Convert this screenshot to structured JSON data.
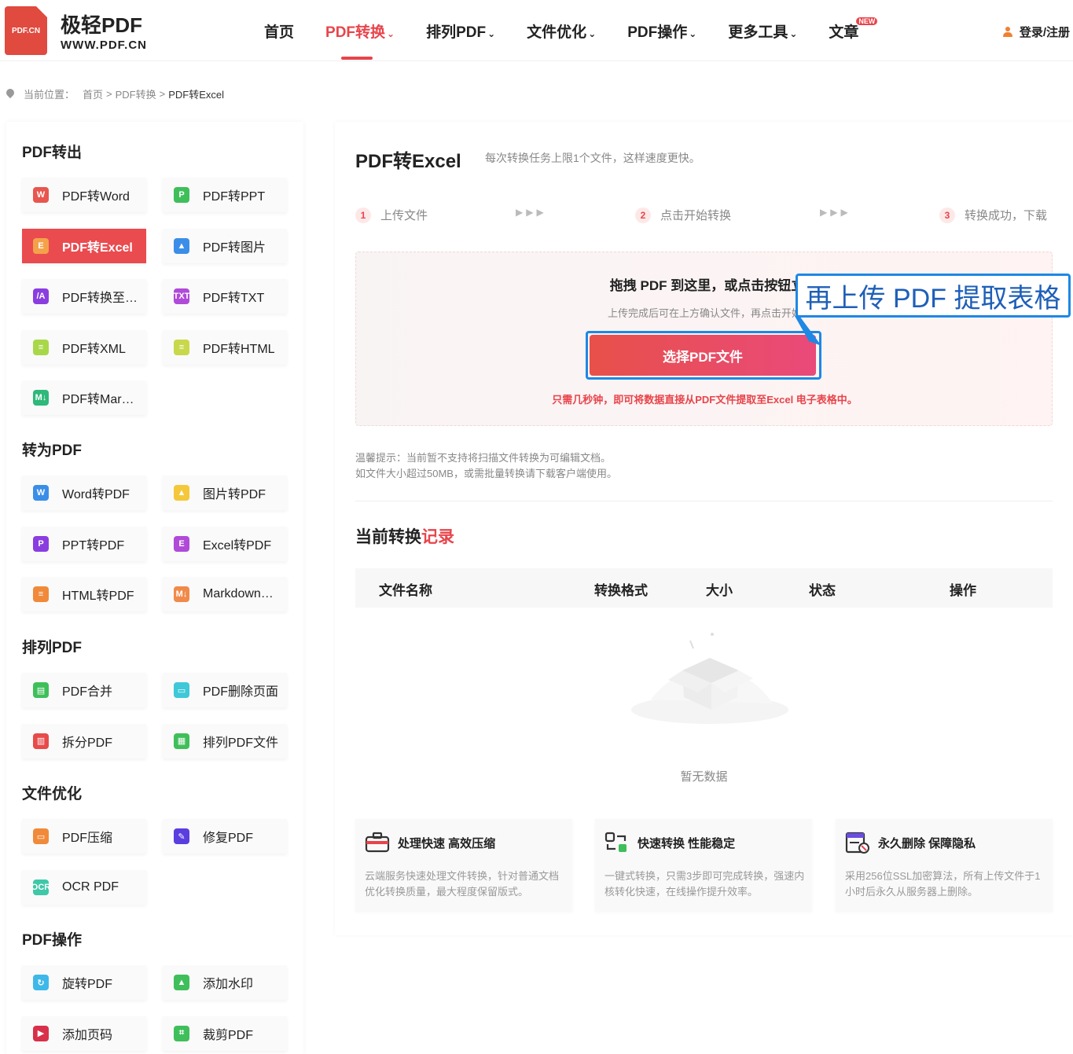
{
  "header": {
    "logo_badge": "PDF.CN",
    "logo_name": "极轻PDF",
    "logo_url": "WWW.PDF.CN",
    "nav": [
      {
        "label": "首页",
        "has_chevron": false
      },
      {
        "label": "PDF转换",
        "has_chevron": true,
        "active": true
      },
      {
        "label": "排列PDF",
        "has_chevron": true
      },
      {
        "label": "文件优化",
        "has_chevron": true
      },
      {
        "label": "PDF操作",
        "has_chevron": true
      },
      {
        "label": "更多工具",
        "has_chevron": true
      },
      {
        "label": "文章",
        "has_chevron": false,
        "badge": "NEW"
      }
    ],
    "chevron": "⌄",
    "login": "登录/注册"
  },
  "breadcrumb": {
    "prefix": "当前位置：",
    "items": [
      "首页",
      "PDF转换",
      "PDF转Excel"
    ],
    "sep": ">"
  },
  "sidebar": {
    "sections": [
      {
        "title": "PDF转出",
        "tools": [
          {
            "label": "PDF转Word",
            "icon": "W",
            "color": "#e8564f"
          },
          {
            "label": "PDF转PPT",
            "icon": "P",
            "color": "#3fbf5a"
          },
          {
            "label": "PDF转Excel",
            "icon": "E",
            "color": "#f4a24a",
            "active": true
          },
          {
            "label": "PDF转图片",
            "icon": "▲",
            "color": "#3b8ee8"
          },
          {
            "label": "PDF转换至…",
            "icon": "/A",
            "color": "#8a3ee0"
          },
          {
            "label": "PDF转TXT",
            "icon": "TXT",
            "color": "#b04ad8"
          },
          {
            "label": "PDF转XML",
            "icon": "≡",
            "color": "#a8d84a"
          },
          {
            "label": "PDF转HTML",
            "icon": "≡",
            "color": "#c8d84a"
          },
          {
            "label": "PDF转Mar…",
            "icon": "M↓",
            "color": "#2eb87a"
          }
        ]
      },
      {
        "title": "转为PDF",
        "tools": [
          {
            "label": "Word转PDF",
            "icon": "W",
            "color": "#3b8ee8"
          },
          {
            "label": "图片转PDF",
            "icon": "▲",
            "color": "#f4c83a"
          },
          {
            "label": "PPT转PDF",
            "icon": "P",
            "color": "#8a3ee0"
          },
          {
            "label": "Excel转PDF",
            "icon": "E",
            "color": "#b04ad8"
          },
          {
            "label": "HTML转PDF",
            "icon": "≡",
            "color": "#f08a3a"
          },
          {
            "label": "Markdown…",
            "icon": "M↓",
            "color": "#f08a4a"
          }
        ]
      },
      {
        "title": "排列PDF",
        "tools": [
          {
            "label": "PDF合并",
            "icon": "▤",
            "color": "#3fbf5a"
          },
          {
            "label": "PDF删除页面",
            "icon": "▭",
            "color": "#3ec8d8"
          },
          {
            "label": "拆分PDF",
            "icon": "▥",
            "color": "#e84a4a"
          },
          {
            "label": "排列PDF文件",
            "icon": "▦",
            "color": "#3fbf5a"
          }
        ]
      },
      {
        "title": "文件优化",
        "tools": [
          {
            "label": "PDF压缩",
            "icon": "▭",
            "color": "#f08a3a"
          },
          {
            "label": "修复PDF",
            "icon": "✎",
            "color": "#5a3ee0"
          },
          {
            "label": "OCR PDF",
            "icon": "OCR",
            "color": "#3ec8a8"
          }
        ]
      },
      {
        "title": "PDF操作",
        "tools": [
          {
            "label": "旋转PDF",
            "icon": "↻",
            "color": "#3eb8e8"
          },
          {
            "label": "添加水印",
            "icon": "▲",
            "color": "#3fbf5a"
          },
          {
            "label": "添加页码",
            "icon": "▶",
            "color": "#d8304a"
          },
          {
            "label": "裁剪PDF",
            "icon": "⌗",
            "color": "#3fbf5a"
          }
        ]
      }
    ]
  },
  "main": {
    "title": "PDF转Excel",
    "subtitle": "每次转换任务上限1个文件，这样速度更快。",
    "steps": [
      {
        "num": "1",
        "label": "上传文件"
      },
      {
        "num": "2",
        "label": "点击开始转换"
      },
      {
        "num": "3",
        "label": "转换成功，下载"
      }
    ],
    "step_arrows": "▶▶▶",
    "drop": {
      "title": "拖拽 PDF 到这里，或点击按钮立即开",
      "subtitle": "上传完成后可在上方确认文件，再点击开始",
      "button": "选择PDF文件",
      "note": "只需几秒钟，即可将数据直接从PDF文件提取至Excel 电子表格中。"
    },
    "tips": [
      "温馨提示：当前暂不支持将扫描文件转换为可编辑文档。",
      "如文件大小超过50MB，或需批量转换请下载客户端使用。"
    ],
    "records": {
      "title_main": "当前转换",
      "title_highlight": "记录",
      "columns": [
        "文件名称",
        "转换格式",
        "大小",
        "状态",
        "操作"
      ],
      "empty": "暂无数据"
    },
    "features": [
      {
        "title": "处理快速 高效压缩",
        "text": "云端服务快速处理文件转换，针对普通文档优化转换质量，最大程度保留版式。",
        "icon": "toolbox-icon"
      },
      {
        "title": "快速转换 性能稳定",
        "text": "一键式转换，只需3步即可完成转换，强速内核转化快速，在线操作提升效率。",
        "icon": "convert-icon"
      },
      {
        "title": "永久删除 保障隐私",
        "text": "采用256位SSL加密算法，所有上传文件于1小时后永久从服务器上删除。",
        "icon": "delete-doc-icon"
      }
    ]
  },
  "callout": "再上传 PDF 提取表格",
  "colors": {
    "accent": "#e8444b",
    "callout": "#1e88e5"
  }
}
